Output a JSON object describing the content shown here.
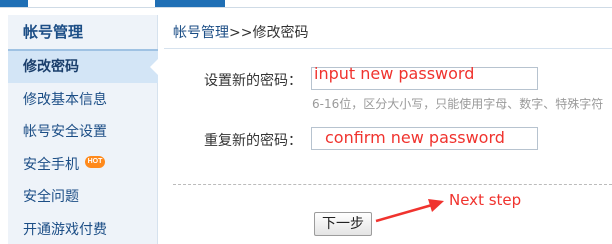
{
  "sidebar": {
    "title": "帐号管理",
    "items": [
      {
        "label": "修改密码",
        "active": true
      },
      {
        "label": "修改基本信息"
      },
      {
        "label": "帐号安全设置"
      },
      {
        "label": "安全手机",
        "badge": "HOT"
      },
      {
        "label": "安全问题"
      },
      {
        "label": "开通游戏付费"
      }
    ]
  },
  "breadcrumb": {
    "parent": "帐号管理",
    "separator": ">>",
    "current": "修改密码"
  },
  "form": {
    "new_password": {
      "label": "设置新的密码：",
      "value": ""
    },
    "hint": "6-16位，区分大小写，只能使用字母、数字、特殊字符",
    "confirm_password": {
      "label": "重复新的密码：",
      "value": ""
    },
    "next_button": "下一步"
  },
  "annotations": {
    "new_password": "input new password",
    "confirm_password": "confirm new password",
    "next_step": "Next step",
    "color": "#f0332e"
  },
  "colors": {
    "link": "#1c4e86",
    "sidebar_bg": "#eef3f9",
    "active_bg": "#d3e5f6",
    "badge": "#ff8a1c"
  }
}
